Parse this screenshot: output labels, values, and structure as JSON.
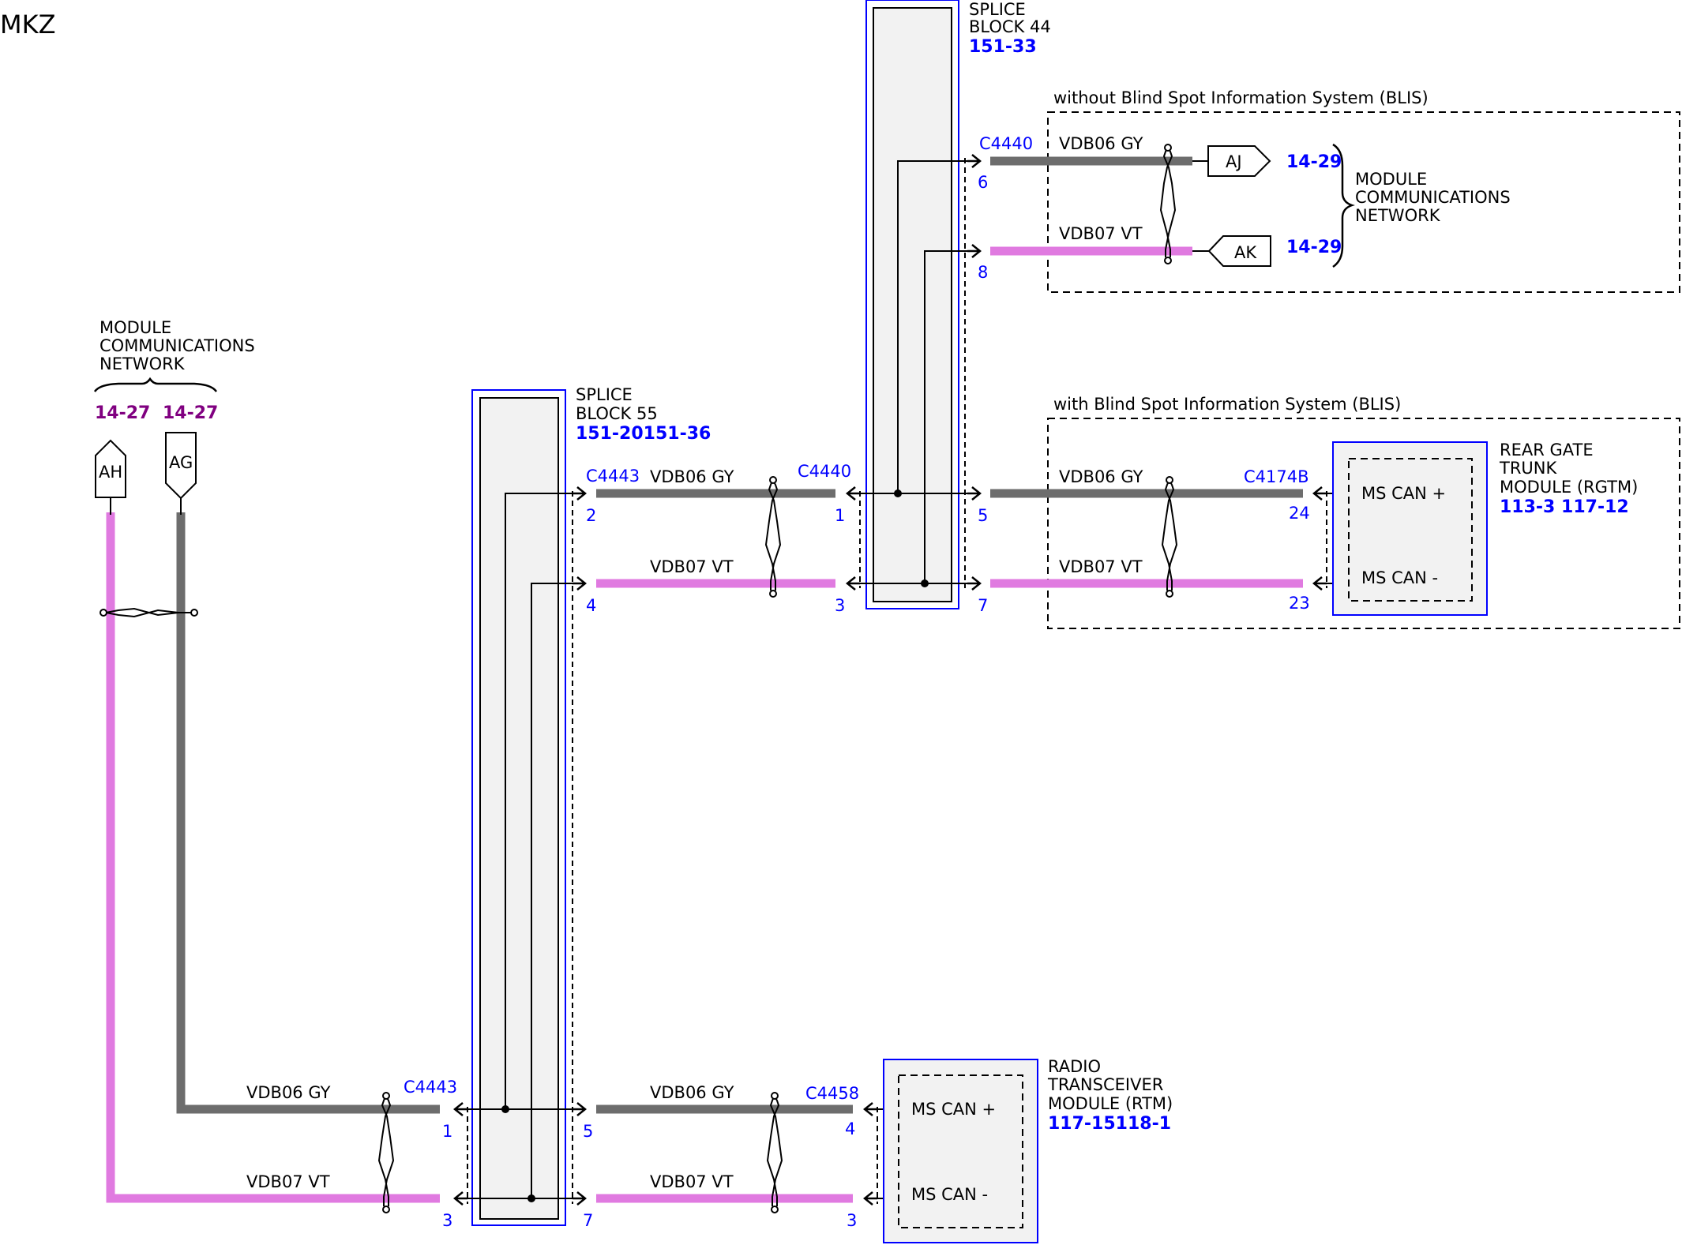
{
  "title": "MKZ",
  "colors": {
    "wire_gy": "#6d6d6d",
    "wire_vt": "#e07ae0",
    "ref_blue": "#0000ff",
    "ref_purple": "#800080",
    "block_fill": "#f2f2f2"
  },
  "module_comm_left": {
    "lines": [
      "MODULE",
      "COMMUNICATIONS",
      "NETWORK"
    ],
    "refs": [
      "14-27",
      "14-27"
    ],
    "connectors": [
      "AH",
      "AG"
    ]
  },
  "module_comm_right": {
    "lines": [
      "MODULE",
      "COMMUNICATIONS",
      "NETWORK"
    ],
    "refs": [
      "14-29",
      "14-29"
    ],
    "connectors": [
      "AJ",
      "AK"
    ]
  },
  "splice_block_44": {
    "lines": [
      "SPLICE",
      "BLOCK 44"
    ],
    "ref": "151-33"
  },
  "splice_block_55": {
    "lines": [
      "SPLICE",
      "BLOCK 55"
    ],
    "ref": "151-20151-36"
  },
  "zones": {
    "without_blis": "without Blind Spot Information System (BLIS)",
    "with_blis": "with Blind Spot Information System (BLIS)"
  },
  "rgtm": {
    "lines": [
      "REAR GATE",
      "TRUNK",
      "MODULE (RGTM)"
    ],
    "refs": "113-3  117-12",
    "pins": [
      "MS CAN +",
      "MS CAN -"
    ]
  },
  "rtm": {
    "lines": [
      "RADIO",
      "TRANSCEIVER",
      "MODULE (RTM)"
    ],
    "refs": "117-15118-1",
    "pins": [
      "MS CAN +",
      "MS CAN -"
    ]
  },
  "wires": {
    "gy": "VDB06  GY",
    "vt": "VDB07  VT"
  },
  "connectors": {
    "c4440_top": "C4440",
    "c4443_mid": "C4443",
    "c4440_mid": "C4440",
    "c4174b": "C4174B",
    "c4443_bot": "C4443",
    "c4458": "C4458"
  },
  "pins": {
    "p6": "6",
    "p8": "8",
    "p2": "2",
    "p4": "4",
    "p1": "1",
    "p3": "3",
    "p5": "5",
    "p7": "7",
    "p24": "24",
    "p23": "23",
    "bl1": "1",
    "bl3": "3",
    "br5": "5",
    "br7": "7",
    "rtm4": "4",
    "rtm3": "3"
  }
}
